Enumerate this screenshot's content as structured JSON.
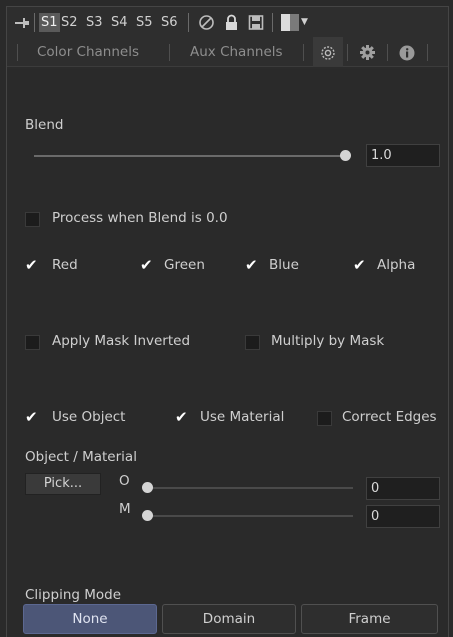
{
  "toolbar": {
    "pin_icon": "pin-icon",
    "slots": [
      "S1",
      "S2",
      "S3",
      "S4",
      "S5",
      "S6"
    ],
    "active_slot": "S1",
    "icons": [
      "no-entry-icon",
      "lock-icon",
      "save-icon",
      "swatch-icon",
      "chevron-down-icon"
    ]
  },
  "tabs": {
    "color_channels": "Color Channels",
    "aux_channels": "Aux Channels",
    "icon_tabs": [
      "mask-icon",
      "gear-icon",
      "info-icon"
    ],
    "active_icon_tab": "mask-icon"
  },
  "blend": {
    "label": "Blend",
    "value": "1.0",
    "level": 1.0
  },
  "process_when_blend_zero": {
    "label": "Process when Blend is 0.0",
    "checked": false
  },
  "channels": [
    {
      "label": "Red",
      "checked": true
    },
    {
      "label": "Green",
      "checked": true
    },
    {
      "label": "Blue",
      "checked": true
    },
    {
      "label": "Alpha",
      "checked": true
    }
  ],
  "mask_options": [
    {
      "label": "Apply Mask Inverted",
      "checked": false
    },
    {
      "label": "Multiply by Mask",
      "checked": false
    }
  ],
  "object_options": [
    {
      "label": "Use Object",
      "checked": true
    },
    {
      "label": "Use Material",
      "checked": true
    },
    {
      "label": "Correct Edges",
      "checked": false
    }
  ],
  "object_material": {
    "label": "Object / Material",
    "pick_label": "Pick...",
    "o_label": "O",
    "o_value": "0",
    "m_label": "M",
    "m_value": "0"
  },
  "clipping": {
    "label": "Clipping Mode",
    "options": [
      "None",
      "Domain",
      "Frame"
    ],
    "selected": "None"
  },
  "colors": {
    "background": "#2a2a2a",
    "accent_selected": "#4c5677",
    "knob": "#d4d4d4"
  }
}
